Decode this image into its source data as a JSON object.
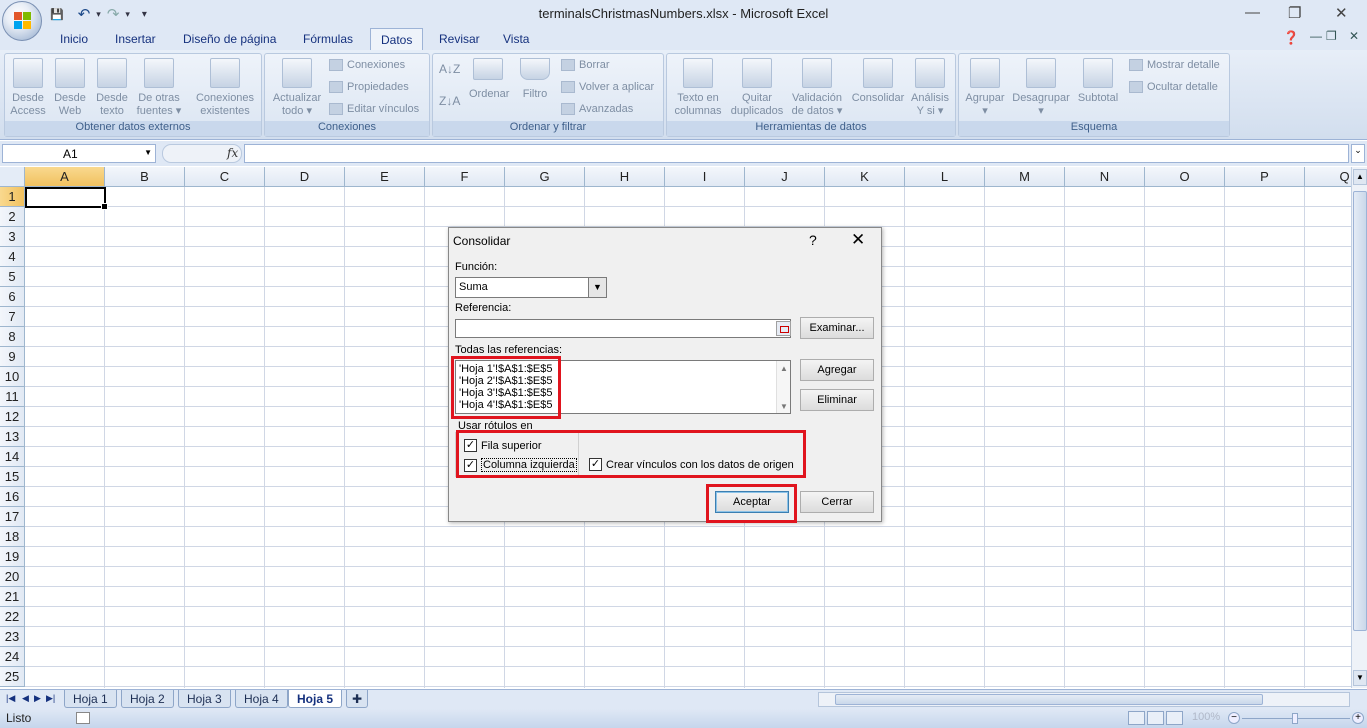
{
  "window": {
    "title": "terminalsChristmasNumbers.xlsx - Microsoft Excel",
    "minimize": "—",
    "restore": "❐",
    "close": "✕"
  },
  "qat": {
    "save": "💾",
    "undo": "↶",
    "redo": "↷",
    "more": "▾"
  },
  "tabs": [
    "Inicio",
    "Insertar",
    "Diseño de página",
    "Fórmulas",
    "Datos",
    "Revisar",
    "Vista"
  ],
  "ribbon": {
    "groups": {
      "external": "Obtener datos externos",
      "connections": "Conexiones",
      "sort": "Ordenar y filtrar",
      "tools": "Herramientas de datos",
      "outline": "Esquema"
    },
    "buttons": {
      "access": [
        "Desde",
        "Access"
      ],
      "web": [
        "Desde",
        "Web"
      ],
      "text": [
        "Desde",
        "texto"
      ],
      "other": [
        "De otras",
        "fuentes ▾"
      ],
      "existing": [
        "Conexiones",
        "existentes"
      ],
      "refresh": [
        "Actualizar",
        "todo ▾"
      ],
      "conn": "Conexiones",
      "props": "Propiedades",
      "editlinks": "Editar vínculos",
      "sort": "Ordenar",
      "filter": "Filtro",
      "clear": "Borrar",
      "reapply": "Volver a aplicar",
      "advanced": "Avanzadas",
      "textcols": [
        "Texto en",
        "columnas"
      ],
      "dups": [
        "Quitar",
        "duplicados"
      ],
      "validation": [
        "Validación",
        "de datos ▾"
      ],
      "consolidate": "Consolidar",
      "whatif": [
        "Análisis",
        "Y si ▾"
      ],
      "group": [
        "Agrupar",
        "▾"
      ],
      "ungroup": [
        "Desagrupar",
        "▾"
      ],
      "subtotal": "Subtotal",
      "showdetail": "Mostrar detalle",
      "hidedetail": "Ocultar detalle"
    }
  },
  "formula_bar": {
    "namebox": "A1",
    "fx": "fx",
    "value": ""
  },
  "grid": {
    "columns": [
      "A",
      "B",
      "C",
      "D",
      "E",
      "F",
      "G",
      "H",
      "I",
      "J",
      "K",
      "L",
      "M",
      "N",
      "O",
      "P",
      "Q"
    ],
    "rows": [
      "1",
      "2",
      "3",
      "4",
      "5",
      "6",
      "7",
      "8",
      "9",
      "10",
      "11",
      "12",
      "13",
      "14",
      "15",
      "16",
      "17",
      "18",
      "19",
      "20",
      "21",
      "22",
      "23",
      "24",
      "25"
    ],
    "active_cell": "A1"
  },
  "sheets": [
    "Hoja 1",
    "Hoja 2",
    "Hoja 3",
    "Hoja 4",
    "Hoja 5"
  ],
  "active_sheet": "Hoja 5",
  "status": {
    "text": "Listo",
    "zoom": "100%"
  },
  "dialog": {
    "title": "Consolidar",
    "help": "?",
    "close": "✕",
    "function_label": "Función:",
    "function_value": "Suma",
    "reference_label": "Referencia:",
    "reference_value": "",
    "browse": "Examinar...",
    "all_refs_label": "Todas las referencias:",
    "references": [
      "'Hoja 1'!$A$1:$E$5",
      "'Hoja 2'!$A$1:$E$5",
      "'Hoja 3'!$A$1:$E$5",
      "'Hoja 4'!$A$1:$E$5"
    ],
    "add": "Agregar",
    "delete": "Eliminar",
    "labels_group": "Usar rótulos en",
    "top_row": "Fila superior",
    "left_column": "Columna izquierda",
    "create_links": "Crear vínculos con los datos de origen",
    "checks": {
      "top_row": true,
      "left_column": true,
      "create_links": true
    },
    "ok": "Aceptar",
    "cancel": "Cerrar"
  },
  "colors": {
    "highlight": "#e0141e",
    "accent": "#15317e",
    "selected_header": "#f1c15f"
  }
}
